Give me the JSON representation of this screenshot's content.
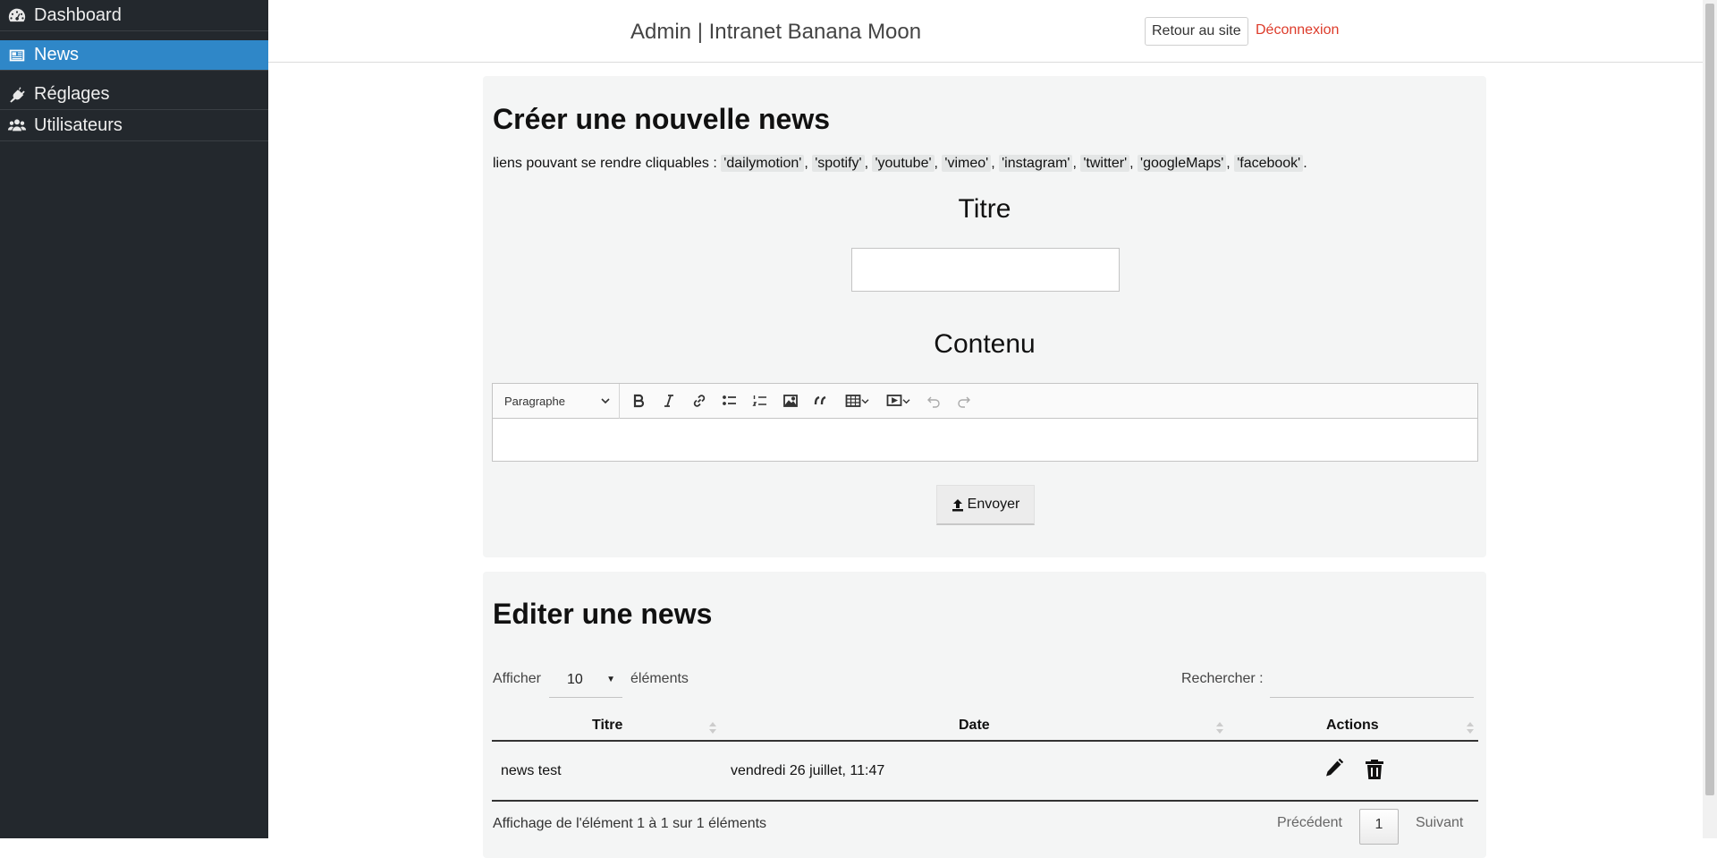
{
  "sidebar": {
    "items": [
      {
        "label": "Dashboard",
        "icon": "dashboard-icon",
        "active": false
      },
      {
        "label": "News",
        "icon": "newspaper-icon",
        "active": true
      },
      {
        "label": "Réglages",
        "icon": "plug-icon",
        "active": false
      },
      {
        "label": "Utilisateurs",
        "icon": "users-icon",
        "active": false
      }
    ]
  },
  "header": {
    "title": "Admin | Intranet Banana Moon",
    "back_button": "Retour au site",
    "logout_link": "Déconnexion"
  },
  "create": {
    "heading": "Créer une nouvelle news",
    "links_intro": "liens pouvant se rendre cliquables :",
    "links": [
      "'dailymotion'",
      "'spotify'",
      "'youtube'",
      "'vimeo'",
      "'instagram'",
      "'twitter'",
      "'googleMaps'",
      "'facebook'"
    ],
    "title_label": "Titre",
    "title_value": "",
    "content_label": "Contenu",
    "format_select": "Paragraphe",
    "toolbar_icons": [
      "bold-icon",
      "italic-icon",
      "link-icon",
      "bulleted-list-icon",
      "numbered-list-icon",
      "image-icon",
      "quote-icon",
      "table-icon",
      "media-embed-icon",
      "undo-icon",
      "redo-icon"
    ],
    "submit_button": "Envoyer",
    "submit_icon": "upload-icon"
  },
  "edit": {
    "heading": "Editer une news",
    "show_label": "Afficher",
    "page_length": "10",
    "elements_label": "éléments",
    "search_label": "Rechercher :",
    "search_value": "",
    "columns": [
      "Titre",
      "Date",
      "Actions"
    ],
    "rows": [
      {
        "title": "news test",
        "date": "vendredi 26 juillet, 11:47",
        "actions": [
          "edit-pencil-icon",
          "delete-trash-icon"
        ]
      }
    ],
    "info": "Affichage de l'élément 1 à 1 sur 1 éléments",
    "prev": "Précédent",
    "current_page": "1",
    "next": "Suivant"
  },
  "colors": {
    "sidebar_bg": "#23282d",
    "active_item": "#2f87c8",
    "logout": "#dd3b2a",
    "panel_bg": "#f4f5f5"
  }
}
